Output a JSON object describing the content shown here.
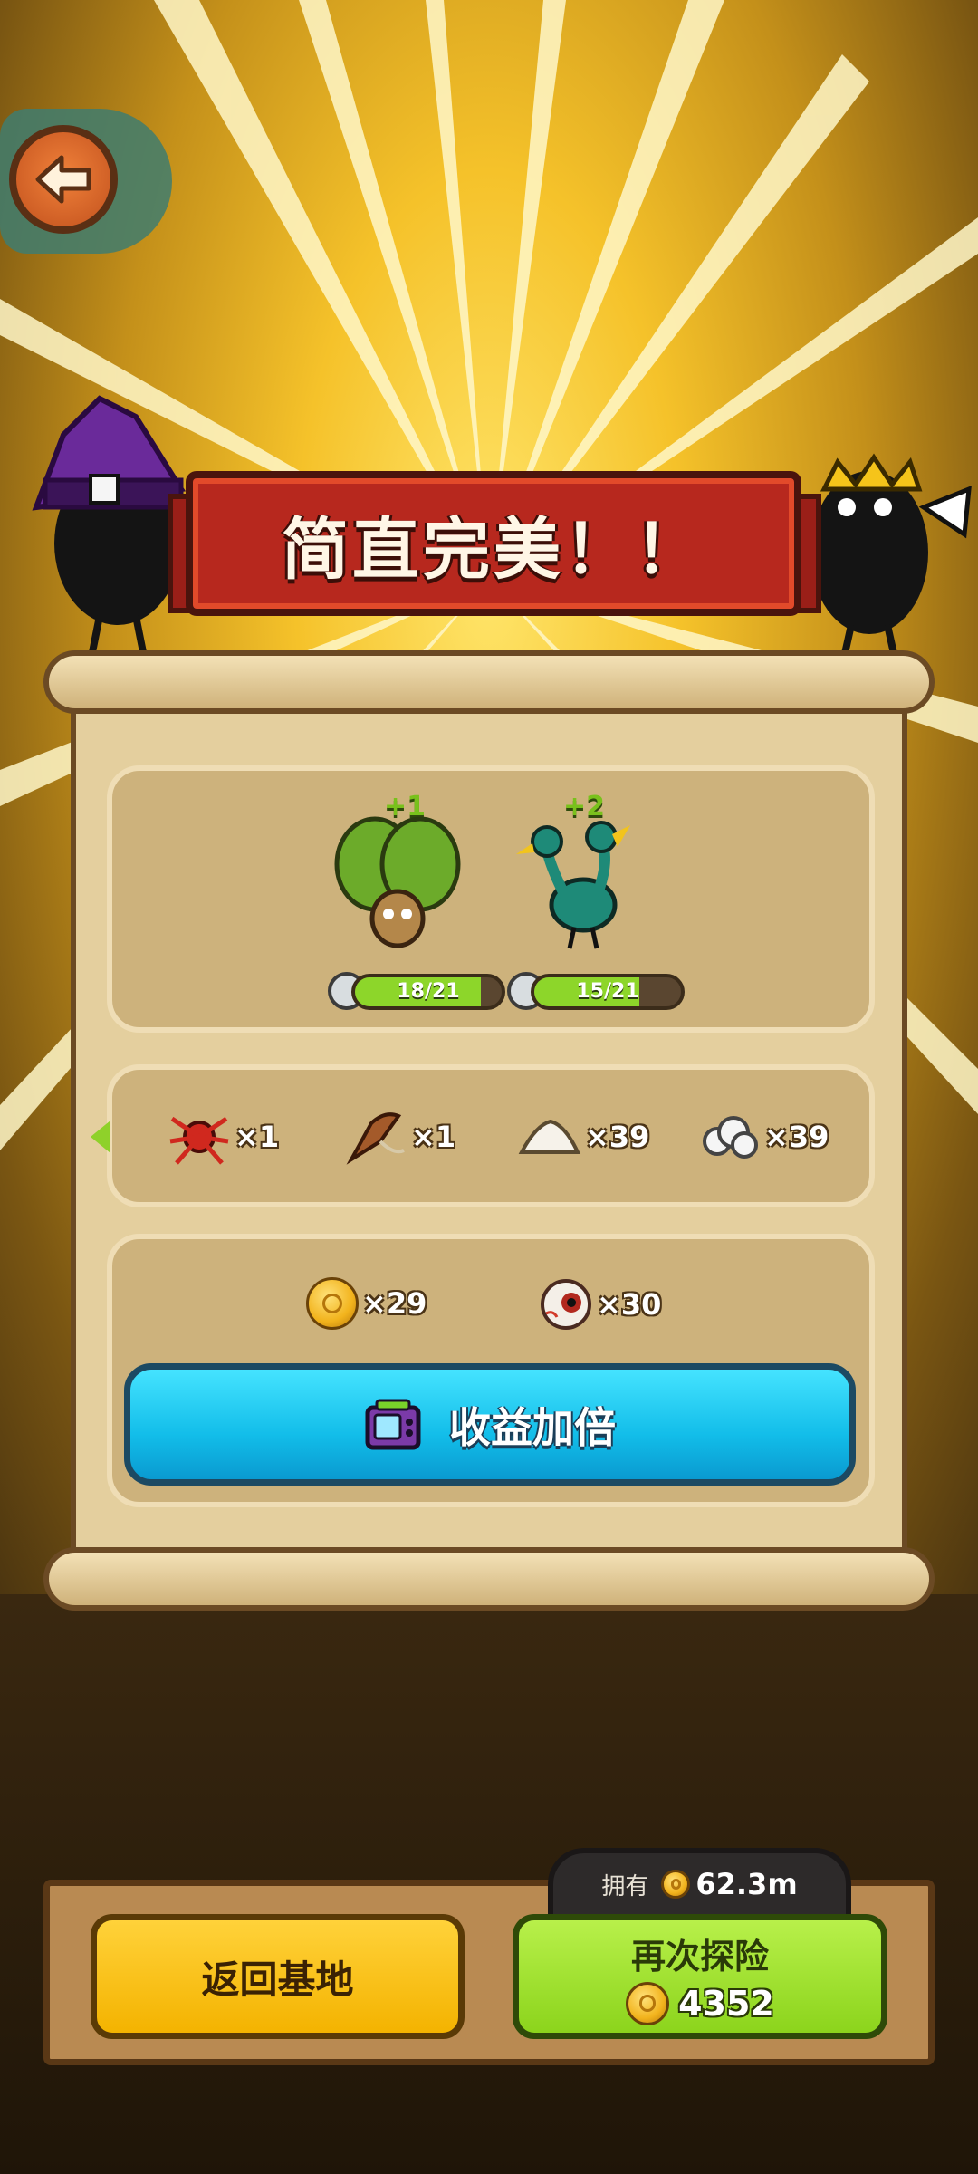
{
  "banner": {
    "title": "简直完美！！"
  },
  "pets": [
    {
      "name_icon": "cactus-pet-icon",
      "plus": "+1",
      "level": "18/21",
      "progress": 0.857
    },
    {
      "name_icon": "two-headed-bird-pet-icon",
      "plus": "+2",
      "level": "15/21",
      "progress": 0.714
    }
  ],
  "items": [
    {
      "icon": "red-spider-icon",
      "qty": "×1"
    },
    {
      "icon": "slingshot-club-icon",
      "qty": "×1"
    },
    {
      "icon": "salt-pile-icon",
      "qty": "×39"
    },
    {
      "icon": "cotton-pile-icon",
      "qty": "×39"
    }
  ],
  "currency": [
    {
      "icon": "gold-coin-icon",
      "qty": "×29"
    },
    {
      "icon": "eyeball-icon",
      "qty": "×30"
    }
  ],
  "double_button": {
    "label": "收益加倍",
    "icon": "video-tv-icon"
  },
  "owned": {
    "label": "拥有",
    "value": "62.3m"
  },
  "buttons": {
    "home": "返回基地",
    "again": "再次探险",
    "again_cost": "4352"
  },
  "colors": {
    "banner_red": "#b7281e",
    "button_cyan": "#12bde9",
    "button_yellow": "#f4b300",
    "button_green": "#8cd41c",
    "level_green": "#8dd62a"
  }
}
